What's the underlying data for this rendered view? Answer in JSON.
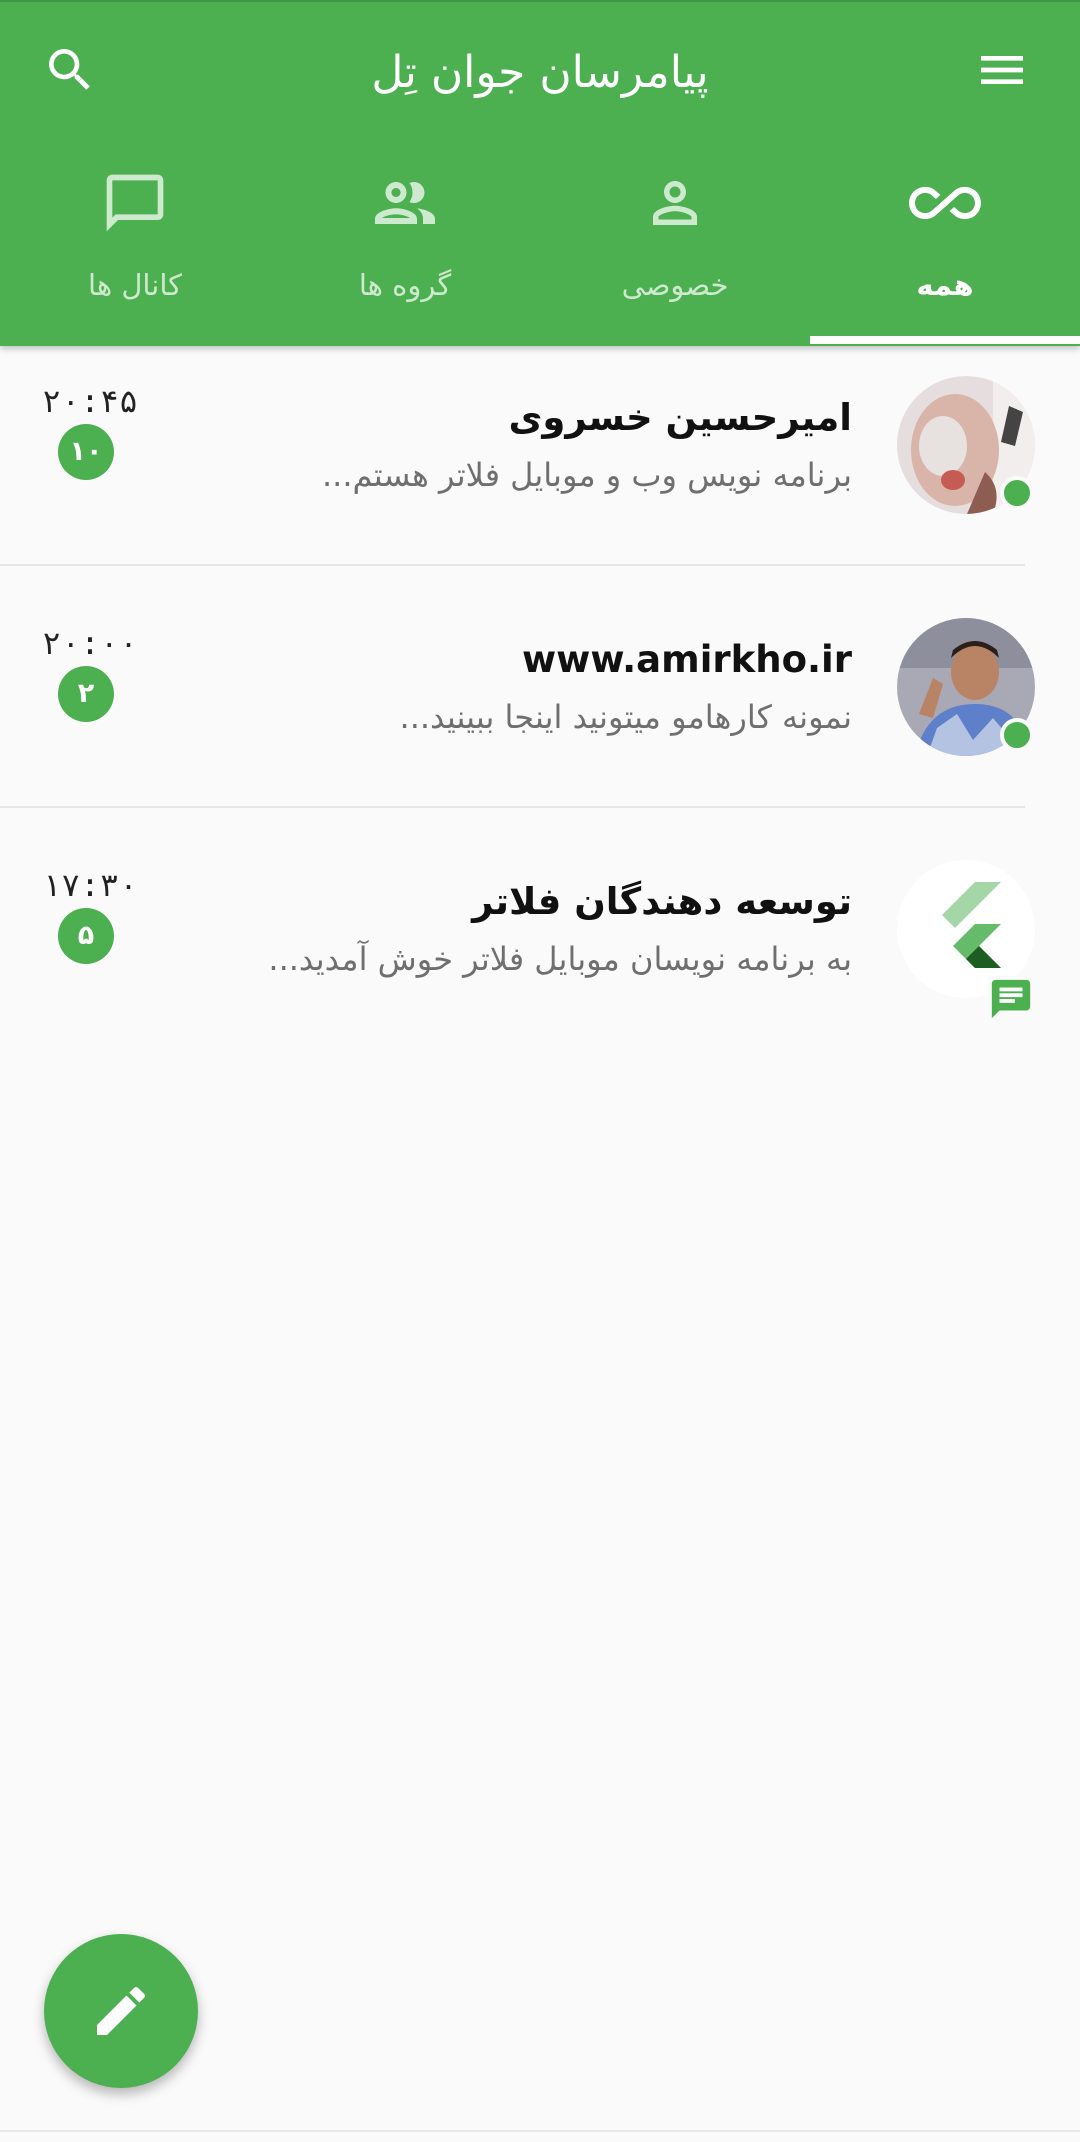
{
  "app": {
    "title": "پیامرسان جوان تِل"
  },
  "colors": {
    "primary": "#4caf50",
    "background": "#fafafa"
  },
  "header": {
    "menu_icon": "menu-icon",
    "search_icon": "search-icon"
  },
  "tabs": [
    {
      "label": "همه",
      "icon": "infinity-icon",
      "active": true
    },
    {
      "label": "خصوصی",
      "icon": "person-icon",
      "active": false
    },
    {
      "label": "گروه ها",
      "icon": "group-icon",
      "active": false
    },
    {
      "label": "کانال ها",
      "icon": "chat-bubble-icon",
      "active": false
    }
  ],
  "chats": [
    {
      "name": "امیرحسین خسروی",
      "preview": "برنامه نویس وب و موبایل فلاتر هستم...",
      "time": "۲۰:۴۵",
      "unread": "۱۰",
      "online": true,
      "type": "private"
    },
    {
      "name": "www.amirkho.ir",
      "preview": "نمونه کارهامو میتونید اینجا ببینید...",
      "time": "۲۰:۰۰",
      "unread": "۲",
      "online": true,
      "type": "private"
    },
    {
      "name": "توسعه دهندگان فلاتر",
      "preview": "به برنامه نویسان موبایل فلاتر خوش آمدید...",
      "time": "۱۷:۳۰",
      "unread": "۵",
      "online": false,
      "type": "channel"
    }
  ],
  "fab": {
    "icon": "pencil-icon"
  }
}
